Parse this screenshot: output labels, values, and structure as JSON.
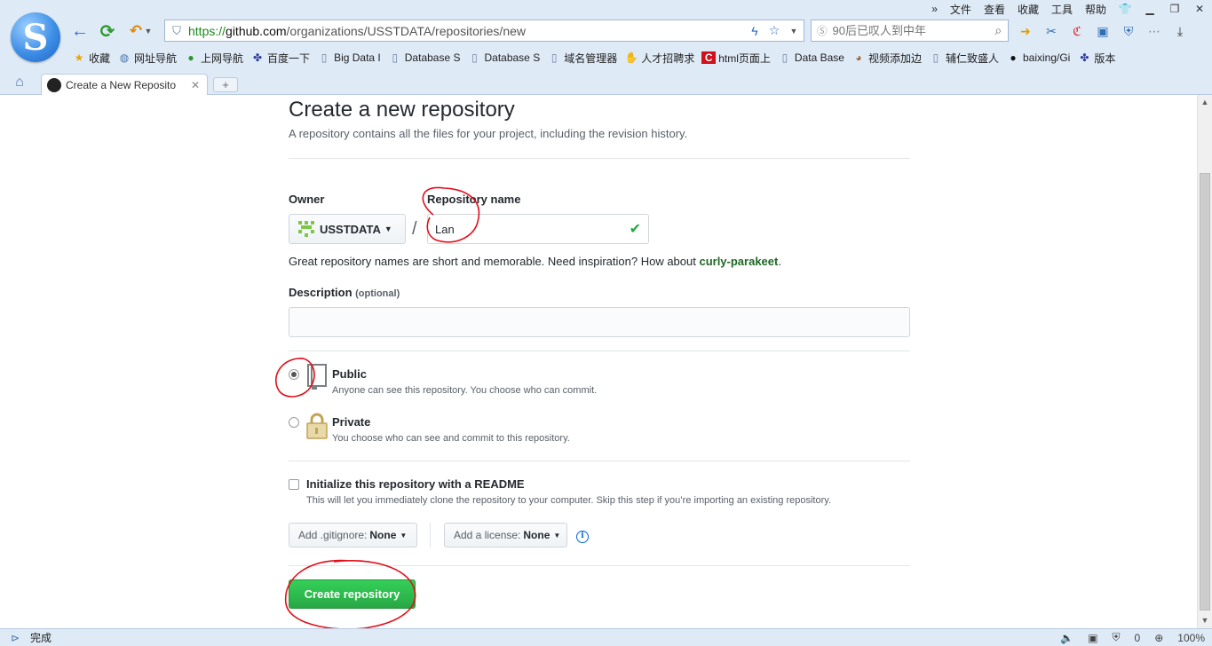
{
  "browser": {
    "menu": [
      "文件",
      "查看",
      "收藏",
      "工具",
      "帮助"
    ],
    "url": {
      "scheme": "https://",
      "host": "github.com",
      "path": "/organizations/USSTDATA/repositories/new"
    },
    "search_placeholder": "90后已叹人到中年",
    "bookmarks": [
      {
        "label": "收藏",
        "icon": "star-icon"
      },
      {
        "label": "网址导航",
        "icon": "globe-icon"
      },
      {
        "label": "上网导航",
        "icon": "navigation-icon"
      },
      {
        "label": "百度一下",
        "icon": "paw-icon"
      },
      {
        "label": "Big Data I",
        "icon": "page-icon"
      },
      {
        "label": "Database S",
        "icon": "page-icon"
      },
      {
        "label": "Database S",
        "icon": "page-icon"
      },
      {
        "label": "域名管理器",
        "icon": "page-icon"
      },
      {
        "label": "人才招聘求",
        "icon": "hand-icon"
      },
      {
        "label": "html页面上",
        "icon": "c-icon"
      },
      {
        "label": "Data Base",
        "icon": "page-icon"
      },
      {
        "label": "视频添加边",
        "icon": "dog-icon"
      },
      {
        "label": "辅仁致盛人",
        "icon": "page-icon"
      },
      {
        "label": "baixing/Gi",
        "icon": "github-icon"
      },
      {
        "label": "版本",
        "icon": "paw-icon"
      }
    ],
    "tab": {
      "title": "Create a New Reposito"
    },
    "status": {
      "text": "完成",
      "shield_count": "0",
      "zoom": "100%"
    }
  },
  "page": {
    "title": "Create a new repository",
    "subtitle": "A repository contains all the files for your project, including the revision history.",
    "owner": {
      "label": "Owner",
      "value": "USSTDATA"
    },
    "separator": "/",
    "repo_name": {
      "label": "Repository name",
      "value": "Lan"
    },
    "hint": {
      "prefix": "Great repository names are short and memorable. Need inspiration? How about ",
      "suggestion": "curly-parakeet",
      "suffix": "."
    },
    "description": {
      "label": "Description",
      "optional": "(optional)",
      "value": ""
    },
    "visibility": {
      "selected": "public",
      "public": {
        "title": "Public",
        "desc": "Anyone can see this repository. You choose who can commit."
      },
      "private": {
        "title": "Private",
        "desc": "You choose who can see and commit to this repository."
      }
    },
    "readme": {
      "title": "Initialize this repository with a README",
      "desc": "This will let you immediately clone the repository to your computer. Skip this step if you’re importing an existing repository.",
      "checked": false
    },
    "gitignore": {
      "label": "Add .gitignore:",
      "value": "None"
    },
    "license": {
      "label": "Add a license:",
      "value": "None"
    },
    "submit": "Create repository"
  },
  "colors": {
    "primary_green": "#28a745",
    "suggestion_green": "#1e6823",
    "annotation_red": "#e0101a"
  }
}
